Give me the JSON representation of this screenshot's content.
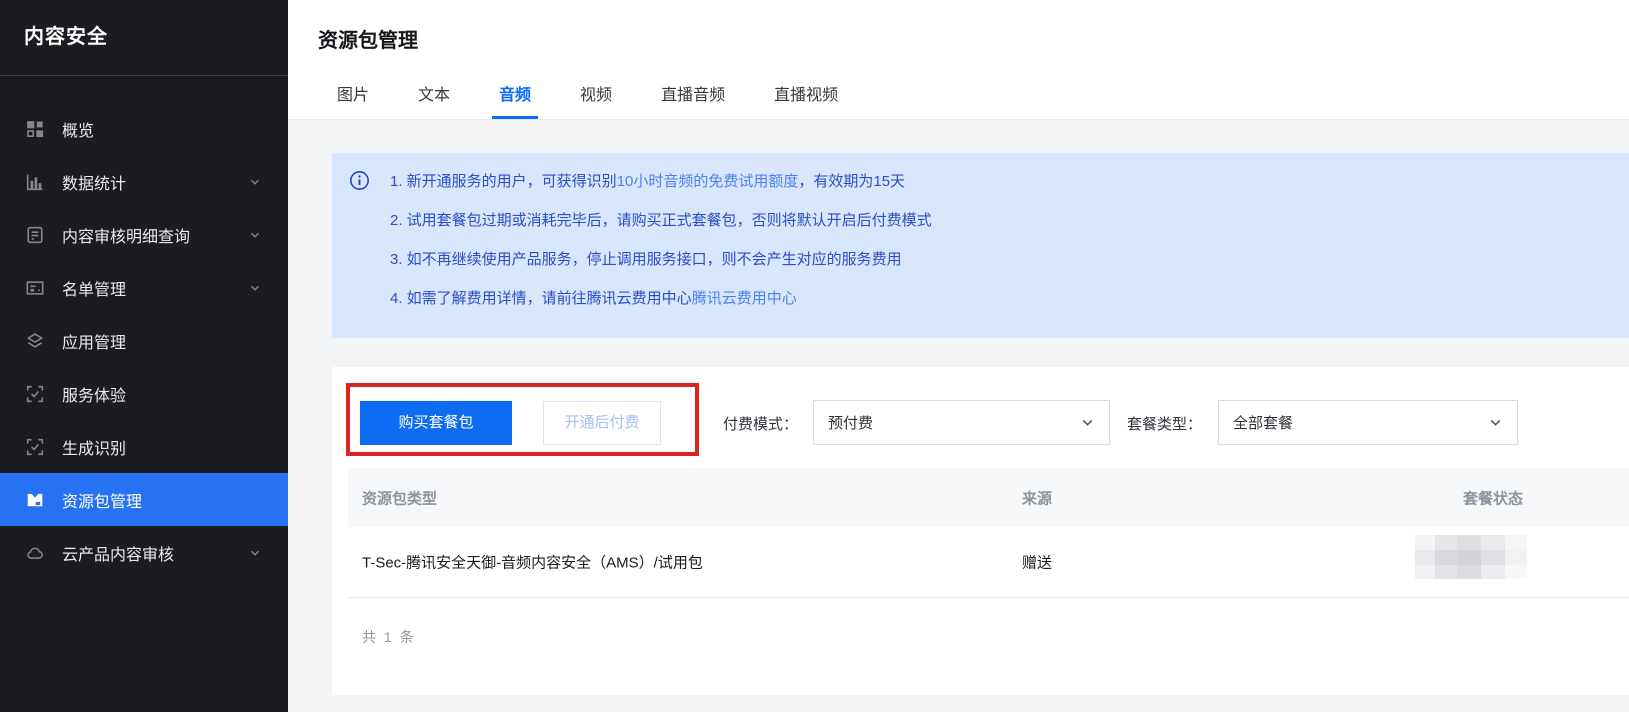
{
  "sidebar": {
    "title": "内容安全",
    "items": [
      {
        "label": "概览",
        "icon": "grid-overview-icon",
        "expandable": false,
        "active": false
      },
      {
        "label": "数据统计",
        "icon": "bar-chart-icon",
        "expandable": true,
        "active": false
      },
      {
        "label": "内容审核明细查询",
        "icon": "document-icon",
        "expandable": true,
        "active": false
      },
      {
        "label": "名单管理",
        "icon": "list-card-icon",
        "expandable": true,
        "active": false
      },
      {
        "label": "应用管理",
        "icon": "layers-icon",
        "expandable": false,
        "active": false
      },
      {
        "label": "服务体验",
        "icon": "scan-check-icon",
        "expandable": false,
        "active": false
      },
      {
        "label": "生成识别",
        "icon": "scan-check-icon",
        "expandable": false,
        "active": false
      },
      {
        "label": "资源包管理",
        "icon": "package-icon",
        "expandable": false,
        "active": true
      },
      {
        "label": "云产品内容审核",
        "icon": "cloud-icon",
        "expandable": true,
        "active": false
      }
    ]
  },
  "header": {
    "title": "资源包管理",
    "tabs": [
      {
        "label": "图片",
        "active": false
      },
      {
        "label": "文本",
        "active": false
      },
      {
        "label": "音频",
        "active": true
      },
      {
        "label": "视频",
        "active": false
      },
      {
        "label": "直播音频",
        "active": false
      },
      {
        "label": "直播视频",
        "active": false
      }
    ]
  },
  "notice": {
    "lines": [
      {
        "pre": "1. 新开通服务的用户，可获得识别",
        "link": "10小时音频的免费试用额度",
        "post": "，有效期为15天"
      },
      {
        "pre": "2. 试用套餐包过期或消耗完毕后，请购买正式套餐包，否则将默认开启后付费模式",
        "link": "",
        "post": ""
      },
      {
        "pre": "3. 如不再继续使用产品服务，停止调用服务接口，则不会产生对应的服务费用",
        "link": "",
        "post": ""
      },
      {
        "pre": "4. 如需了解费用详情，请前往腾讯云费用中心",
        "link": "腾讯云费用中心",
        "post": ""
      }
    ]
  },
  "toolbar": {
    "buy_button": "购买套餐包",
    "postpaid_button": "开通后付费",
    "pay_mode_label": "付费模式：",
    "pay_mode_value": "预付费",
    "package_type_label": "套餐类型：",
    "package_type_value": "全部套餐"
  },
  "table": {
    "columns": [
      "资源包类型",
      "来源",
      "套餐状态"
    ],
    "rows": [
      {
        "type": "T-Sec-腾讯安全天御-音频内容安全（AMS）/试用包",
        "source": "赠送",
        "status_censored": true
      }
    ]
  },
  "footer": {
    "total": "共 1 条"
  },
  "colors": {
    "sidebar_bg": "#1b1c20",
    "sidebar_active": "#2672f2",
    "primary_button": "#0d6cf2",
    "tab_active": "#0a6cff",
    "notice_bg": "#d8e6fc",
    "notice_text": "#2b4ec7",
    "notice_link": "#4d80f0",
    "annotation_red": "#dd2420",
    "page_bg": "#f3f4f6"
  }
}
